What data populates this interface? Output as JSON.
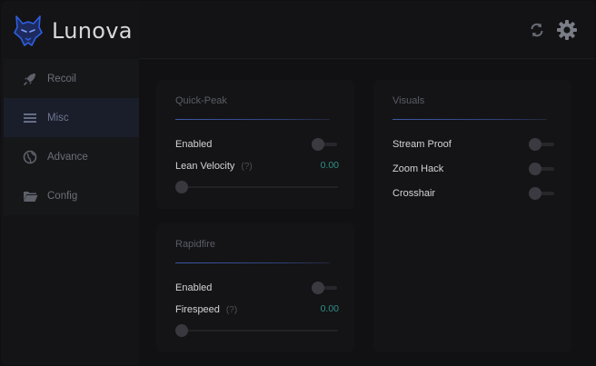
{
  "app": {
    "title": "Lunova"
  },
  "sidebar": {
    "items": [
      {
        "label": "Recoil",
        "icon": "rocket-icon",
        "active": false
      },
      {
        "label": "Misc",
        "icon": "menu-icon",
        "active": true
      },
      {
        "label": "Advance",
        "icon": "globe-icon",
        "active": false
      },
      {
        "label": "Config",
        "icon": "folder-icon",
        "active": false
      }
    ]
  },
  "header": {
    "icons": [
      "refresh-icon",
      "settings-gear-icon"
    ]
  },
  "quick_peak": {
    "title": "Quick-Peak",
    "enabled_label": "Enabled",
    "enabled": false,
    "lean_label": "Lean Velocity",
    "lean_help": "(?)",
    "lean_value": "0.00",
    "lean_fraction": 0
  },
  "rapidfire": {
    "title": "Rapidfire",
    "enabled_label": "Enabled",
    "enabled": false,
    "speed_label": "Firespeed",
    "speed_help": "(?)",
    "speed_value": "0.00",
    "speed_fraction": 0
  },
  "visuals": {
    "title": "Visuals",
    "items": [
      {
        "label": "Stream Proof",
        "enabled": false
      },
      {
        "label": "Zoom Hack",
        "enabled": false
      },
      {
        "label": "Crosshair",
        "enabled": false
      }
    ]
  },
  "colors": {
    "accent": "#3d5aa8",
    "value_teal": "#2f8f86",
    "logo_blue": "#2f5fe0"
  }
}
